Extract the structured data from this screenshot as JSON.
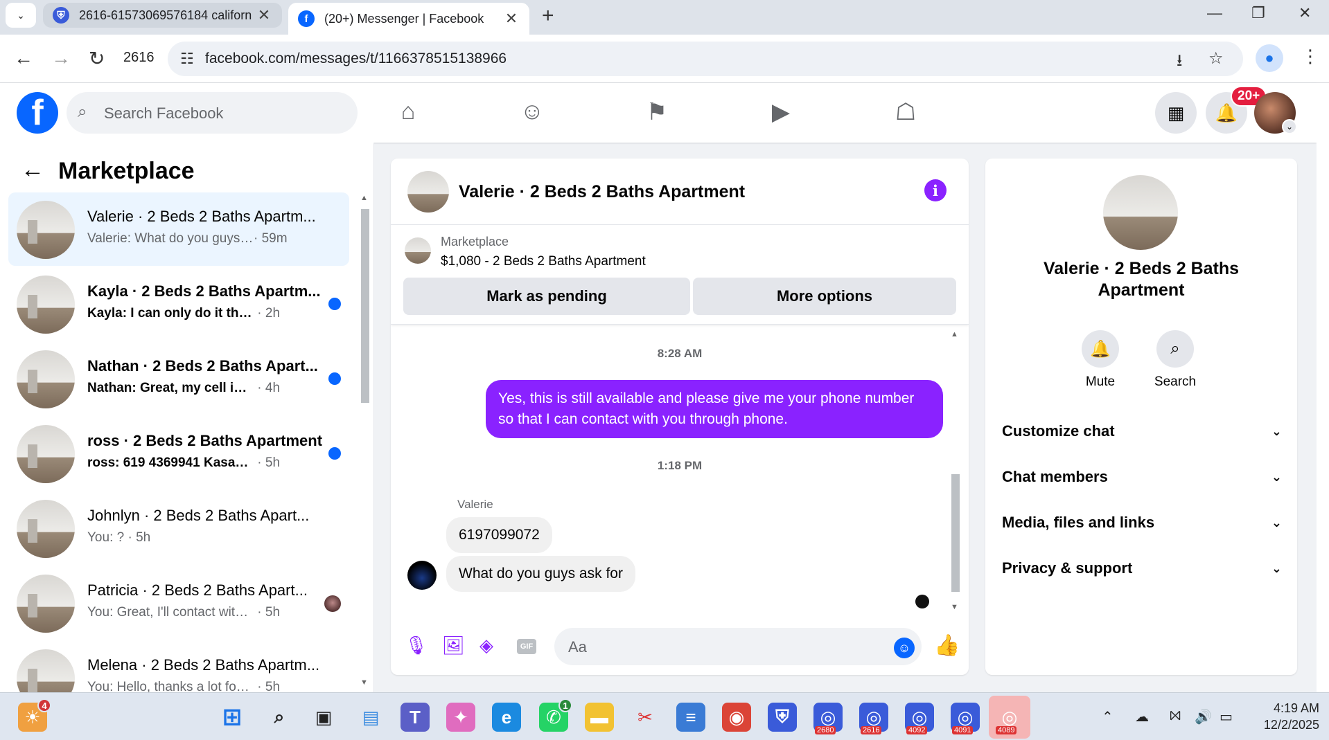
{
  "browser": {
    "tabs": [
      {
        "title": "2616-61573069576184 californ",
        "favicon": "shield-icon",
        "active": false
      },
      {
        "title": "(20+) Messenger | Facebook",
        "favicon": "facebook-icon",
        "active": true
      }
    ],
    "profile_label": "2616",
    "url": "facebook.com/messages/t/1166378515138966"
  },
  "fb_header": {
    "search_placeholder": "Search Facebook",
    "notification_badge": "20+"
  },
  "left_panel": {
    "title": "Marketplace",
    "chats": [
      {
        "name": "Valerie · 2 Beds 2 Baths Apartm...",
        "preview": "Valerie: What do you guys ask for",
        "time": "· 59m",
        "unread": false,
        "active": true
      },
      {
        "name": "Kayla · 2 Beds 2 Baths Apartm...",
        "preview": "Kayla: I can only do it through ...",
        "time": " · 2h",
        "unread": true,
        "active": false
      },
      {
        "name": "Nathan · 2 Beds 2 Baths Apart...",
        "preview": "Nathan: Great, my cell is 858-76...",
        "time": " · 4h",
        "unread": true,
        "active": false
      },
      {
        "name": "ross · 2 Beds 2 Baths Apartment",
        "preview": "ross: 619 4369941 Kasandra",
        "time": " · 5h",
        "unread": true,
        "active": false
      },
      {
        "name": "Johnlyn · 2 Beds 2 Baths Apart...",
        "preview": "You: ?",
        "time": " · 5h",
        "unread": false,
        "active": false
      },
      {
        "name": "Patricia · 2 Beds 2 Baths Apart...",
        "preview": "You: Great, I'll contact with u so...",
        "time": " · 5h",
        "unread": false,
        "active": false
      },
      {
        "name": "Melena · 2 Beds 2 Baths Apartm...",
        "preview": "You: Hello, thanks a lot for your int...",
        "time": " · 5h",
        "unread": false,
        "active": false
      }
    ]
  },
  "conversation": {
    "title": "Valerie · 2 Beds 2 Baths Apartment",
    "listing": {
      "category": "Marketplace",
      "price_title": "$1,080 - 2 Beds 2 Baths Apartment",
      "mark_pending_label": "Mark as pending",
      "more_options_label": "More options"
    },
    "messages": {
      "ts1": "8:28 AM",
      "outgoing": "Yes, this is still available and please give me your phone number so that I can contact with you through phone.",
      "ts2": "1:18 PM",
      "sender": "Valerie",
      "incoming1": "6197099072",
      "incoming2": "What do you guys ask for"
    },
    "composer_placeholder": "Aa",
    "accent_color": "#8a22ff"
  },
  "info_panel": {
    "name": "Valerie · 2 Beds 2 Baths Apartment",
    "mute_label": "Mute",
    "search_label": "Search",
    "sections": [
      "Customize chat",
      "Chat members",
      "Media, files and links",
      "Privacy & support"
    ]
  },
  "taskbar": {
    "weather_badge": "4",
    "whatsapp_badge": "1",
    "app_counts": [
      "2680",
      "2616",
      "4092",
      "4091",
      "4089"
    ],
    "time": "4:19 AM",
    "date": "12/2/2025"
  }
}
